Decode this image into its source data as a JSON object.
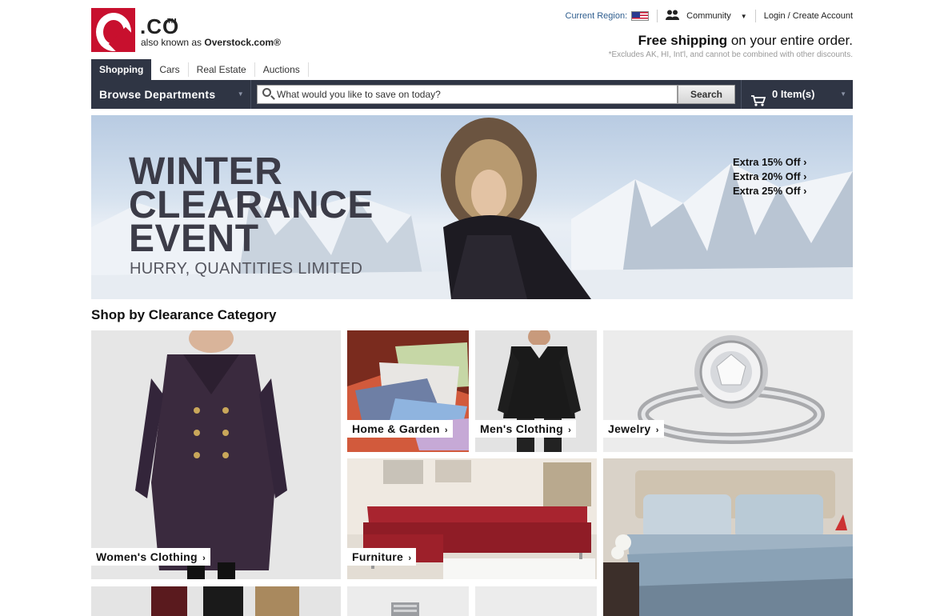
{
  "brand": {
    "logo_text": "O",
    "co": ".CO",
    "tm": "TM",
    "aka_prefix": "also known as",
    "aka_name": "Overstock.com®"
  },
  "utility": {
    "region_label": "Current Region:",
    "community_label": "Community",
    "login_label": "Login / Create Account",
    "icons": [
      "us-flag-icon",
      "community-icon",
      "chevron-down-icon"
    ]
  },
  "shipping": {
    "headline_bold": "Free shipping",
    "headline_rest": "on your entire order.",
    "note": "*Excludes AK, HI, Int'l, and cannot be combined with other discounts."
  },
  "tabs": [
    {
      "label": "Shopping",
      "active": true
    },
    {
      "label": "Cars",
      "active": false
    },
    {
      "label": "Real Estate",
      "active": false
    },
    {
      "label": "Auctions",
      "active": false
    }
  ],
  "nav": {
    "browse_label": "Browse Departments",
    "search_placeholder": "What would you like to save on today?",
    "search_button": "Search",
    "cart_label": "0 Item(s)"
  },
  "hero": {
    "title_line1": "WINTER",
    "title_line2": "CLEARANCE",
    "title_line3": "EVENT",
    "subtitle": "HURRY, QUANTITIES LIMITED",
    "offers": [
      "Extra 15% Off",
      "Extra 20% Off",
      "Extra 25% Off"
    ]
  },
  "section": {
    "title": "Shop by Clearance Category"
  },
  "categories": [
    {
      "label": "Women's Clothing"
    },
    {
      "label": "Home & Garden"
    },
    {
      "label": "Men's Clothing"
    },
    {
      "label": "Jewelry"
    },
    {
      "label": "Furniture"
    }
  ],
  "colors": {
    "brand_red": "#c8102e",
    "nav_dark": "#2f3544",
    "region_blue": "#2e5d8e"
  }
}
